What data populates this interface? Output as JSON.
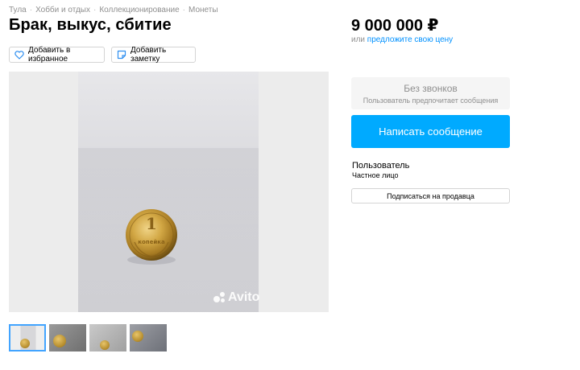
{
  "breadcrumb": {
    "items": [
      "Тула",
      "Хобби и отдых",
      "Коллекционирование",
      "Монеты"
    ],
    "separator": "·"
  },
  "listing": {
    "title": "Брак, выкус, сбитие",
    "price": "9 000 000 ₽",
    "offer_prefix": "или",
    "offer_link": "предложите свою цену"
  },
  "actions": {
    "favorite_label": "Добавить в избранное",
    "note_label": "Добавить заметку"
  },
  "gallery": {
    "watermark": "Avito",
    "coin_denomination": "1",
    "coin_word": "копейка",
    "thumbnail_count": 4,
    "active_thumbnail": 1
  },
  "contact": {
    "no_calls_title": "Без звонков",
    "no_calls_subtitle": "Пользователь предпочитает сообщения",
    "write_button": "Написать сообщение"
  },
  "seller": {
    "name": "Пользователь",
    "type": "Частное лицо",
    "subscribe_button": "Подписаться на продавца"
  },
  "colors": {
    "accent": "#00aaff",
    "link": "#0091ff",
    "muted_text": "#8f8f8f",
    "active_thumb_border": "#42a4ff"
  },
  "icons": {
    "favorite": "heart-icon",
    "note": "note-icon",
    "watermark": "avito-logo-icon"
  }
}
